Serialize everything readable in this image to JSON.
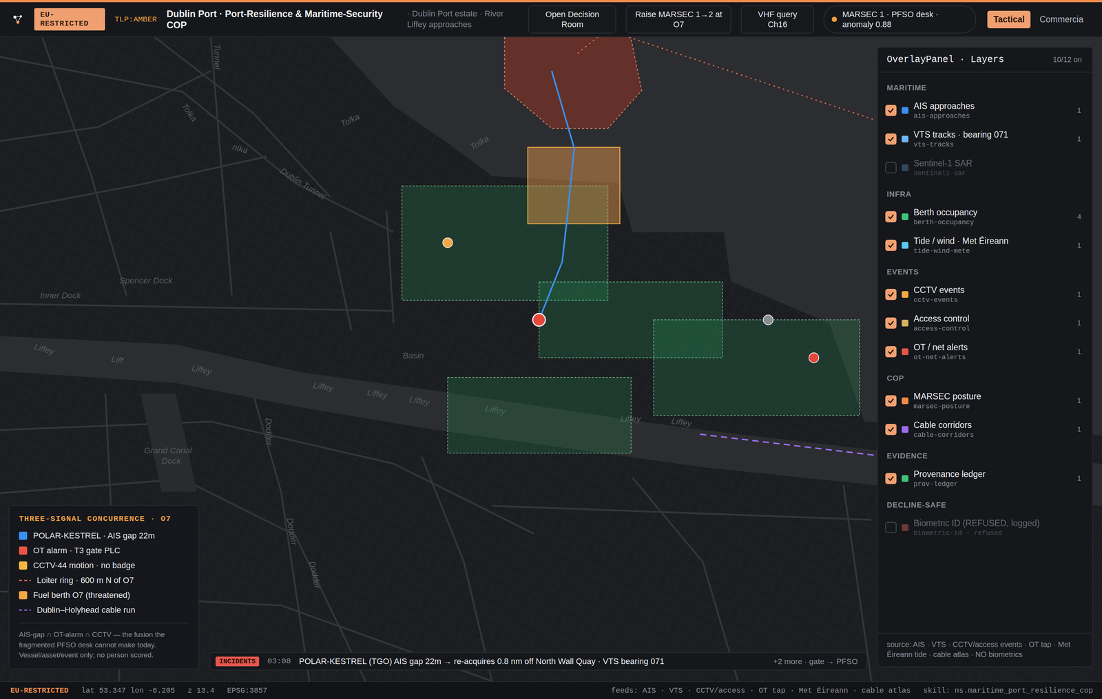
{
  "topbar": {
    "classification": "EU-RESTRICTED",
    "tlp": "TLP:AMBER",
    "title": "Dublin Port · Port-Resilience & Maritime-Security COP",
    "subtitle": "· Dublin Port estate · River Liffey approaches",
    "actions": [
      "Open Decision Room",
      "Raise MARSEC 1→2 at O7",
      "VHF query Ch16"
    ],
    "status": {
      "text": "MARSEC 1 · PFSO desk · anomaly 0.88",
      "color": "#f0a040"
    },
    "tabs": [
      {
        "label": "Tactical",
        "selected": true
      },
      {
        "label": "Commercia",
        "selected": false
      }
    ]
  },
  "map": {
    "labels": [
      "Tolka",
      "Tolka",
      "Tolka",
      "nika",
      "Dublin Tunnel",
      "Tunnel",
      "Spencer Dock",
      "Inner Dock",
      "Liffey",
      "Liff",
      "Liffey",
      "Liffey",
      "Liffey",
      "Liffey",
      "Liffey",
      "Liffey",
      "Liffey",
      "Basin",
      "Grand Canal",
      "Dock",
      "Dodder",
      "Dodder",
      "Dodder"
    ],
    "pins": [
      {
        "kind": "dot",
        "color": "#f5a742"
      },
      {
        "kind": "anchor",
        "color": "#e5483b"
      },
      {
        "kind": "dot",
        "color": "#8a8d93"
      },
      {
        "kind": "dot",
        "color": "#e5483b"
      }
    ]
  },
  "overlay_panel": {
    "title": "OverlayPanel · Layers",
    "count": "10/12 on",
    "groups": [
      {
        "name": "MARITIME",
        "layers": [
          {
            "name": "AIS approaches",
            "id": "ais-approaches",
            "count": "1",
            "checked": true,
            "disabled": false,
            "color": "#3b8ff0"
          },
          {
            "name": "VTS tracks · bearing 071",
            "id": "vts-tracks",
            "count": "1",
            "checked": true,
            "disabled": false,
            "color": "#6cb8f5"
          },
          {
            "name": "Sentinel-1 SAR",
            "id": "sentinel1-sar",
            "count": "",
            "checked": false,
            "disabled": true,
            "color": "#34465e"
          }
        ]
      },
      {
        "name": "INFRA",
        "layers": [
          {
            "name": "Berth occupancy",
            "id": "berth-occupancy",
            "count": "4",
            "checked": true,
            "disabled": false,
            "color": "#3ec47a"
          },
          {
            "name": "Tide / wind · Met Éireann",
            "id": "tide-wind-mete",
            "count": "1",
            "checked": true,
            "disabled": false,
            "color": "#5bc8f0"
          }
        ]
      },
      {
        "name": "EVENTS",
        "layers": [
          {
            "name": "CCTV events",
            "id": "cctv-events",
            "count": "1",
            "checked": true,
            "disabled": false,
            "color": "#f5a742"
          },
          {
            "name": "Access control",
            "id": "access-control",
            "count": "1",
            "checked": true,
            "disabled": false,
            "color": "#d4b060"
          },
          {
            "name": "OT / net alerts",
            "id": "ot-net-alerts",
            "count": "1",
            "checked": true,
            "disabled": false,
            "color": "#e85545"
          }
        ]
      },
      {
        "name": "COP",
        "layers": [
          {
            "name": "MARSEC posture",
            "id": "marsec-posture",
            "count": "1",
            "checked": true,
            "disabled": false,
            "color": "#f08a4b"
          },
          {
            "name": "Cable corridors",
            "id": "cable-corridors",
            "count": "1",
            "checked": true,
            "disabled": false,
            "color": "#9b6cf0"
          }
        ]
      },
      {
        "name": "EVIDENCE",
        "layers": [
          {
            "name": "Provenance ledger",
            "id": "prov-ledger",
            "count": "1",
            "checked": true,
            "disabled": false,
            "color": "#3ec47a"
          }
        ]
      },
      {
        "name": "DECLINE-SAFE",
        "layers": [
          {
            "name": "Biometric ID (REFUSED, logged)",
            "id": "biometric-id · refused",
            "count": "",
            "checked": false,
            "disabled": true,
            "color": "#6b3a36"
          }
        ]
      }
    ],
    "source": "source: AIS · VTS · CCTV/access events · OT tap · Met Éireann tide · cable atlas · NO biometrics"
  },
  "legend": {
    "title": "THREE-SIGNAL CONCURRENCE · O7",
    "items": [
      {
        "kind": "swatch",
        "label": "POLAR-KESTREL · AIS gap 22m",
        "color": "#3b8ff0"
      },
      {
        "kind": "swatch",
        "label": "OT alarm · T3 gate PLC",
        "color": "#e85545"
      },
      {
        "kind": "swatch",
        "label": "CCTV-44 motion · no badge",
        "color": "#f5b942"
      },
      {
        "kind": "dash",
        "label": "Loiter ring · 600 m N of O7",
        "color": "#f07050"
      },
      {
        "kind": "swatch",
        "label": "Fuel berth O7 (threatened)",
        "color": "#f5a742"
      },
      {
        "kind": "dash",
        "label": "Dublin–Holyhead cable run",
        "color": "#9b6cf0"
      }
    ],
    "note": "AIS-gap ∩ OT-alarm ∩ CCTV — the fusion the fragmented PFSO desk cannot make today. Vessel/asset/event only; no person scored."
  },
  "incidents": {
    "badge": "INCIDENTS",
    "time": "03:08",
    "text": "POLAR-KESTREL (TGO) AIS gap 22m → re-acquires 0.8 nm off North Wall Quay · VTS bearing 071",
    "more": "+2 more · gate → PFSO"
  },
  "status_bar": {
    "classification": "EU-RESTRICTED",
    "coords": "lat 53.347 lon -6.205",
    "zoom": "z 13.4",
    "projection": "EPSG:3857",
    "feeds": "feeds: AIS · VTS · CCTV/access · OT tap · Met Éireann · cable atlas",
    "skill": "skill: ns.maritime_port_resilience_cop"
  }
}
